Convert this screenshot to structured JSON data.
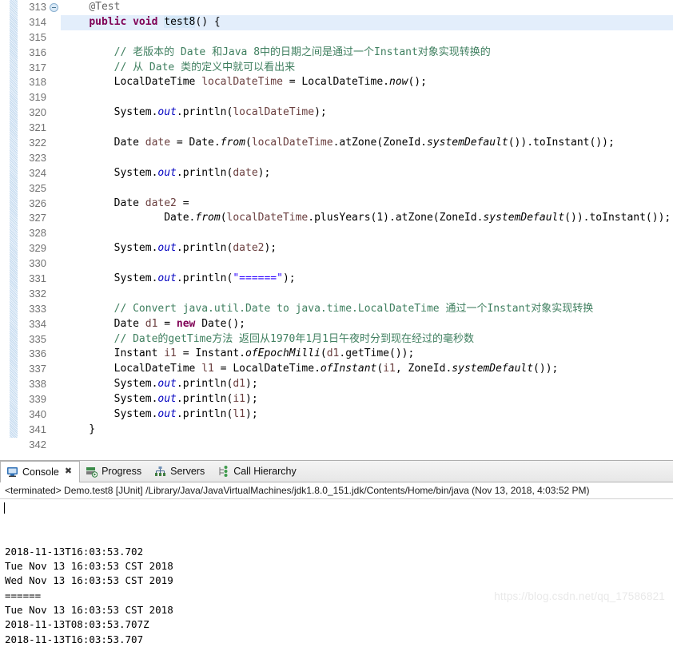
{
  "editor": {
    "first_line_number": 313,
    "highlighted_line_number": 314,
    "occurrence_token": "test8",
    "lines": [
      {
        "n": 313,
        "fold": true,
        "text": "    @Test"
      },
      {
        "n": 314,
        "fold": false,
        "text": "    public void test8() {"
      },
      {
        "n": 315,
        "fold": false,
        "text": ""
      },
      {
        "n": 316,
        "fold": false,
        "text": "        // 老版本的 Date 和Java 8中的日期之间是通过一个Instant对象实现转换的"
      },
      {
        "n": 317,
        "fold": false,
        "text": "        // 从 Date 类的定义中就可以看出来"
      },
      {
        "n": 318,
        "fold": false,
        "text": "        LocalDateTime localDateTime = LocalDateTime.now();"
      },
      {
        "n": 319,
        "fold": false,
        "text": ""
      },
      {
        "n": 320,
        "fold": false,
        "text": "        System.out.println(localDateTime);"
      },
      {
        "n": 321,
        "fold": false,
        "text": ""
      },
      {
        "n": 322,
        "fold": false,
        "text": "        Date date = Date.from(localDateTime.atZone(ZoneId.systemDefault()).toInstant());"
      },
      {
        "n": 323,
        "fold": false,
        "text": ""
      },
      {
        "n": 324,
        "fold": false,
        "text": "        System.out.println(date);"
      },
      {
        "n": 325,
        "fold": false,
        "text": ""
      },
      {
        "n": 326,
        "fold": false,
        "text": "        Date date2 ="
      },
      {
        "n": 327,
        "fold": false,
        "text": "                Date.from(localDateTime.plusYears(1).atZone(ZoneId.systemDefault()).toInstant());"
      },
      {
        "n": 328,
        "fold": false,
        "text": ""
      },
      {
        "n": 329,
        "fold": false,
        "text": "        System.out.println(date2);"
      },
      {
        "n": 330,
        "fold": false,
        "text": ""
      },
      {
        "n": 331,
        "fold": false,
        "text": "        System.out.println(\"======\");"
      },
      {
        "n": 332,
        "fold": false,
        "text": ""
      },
      {
        "n": 333,
        "fold": false,
        "text": "        // Convert java.util.Date to java.time.LocalDateTime 通过一个Instant对象实现转换"
      },
      {
        "n": 334,
        "fold": false,
        "text": "        Date d1 = new Date();"
      },
      {
        "n": 335,
        "fold": false,
        "text": "        // Date的getTime方法 返回从1970年1月1日午夜时分到现在经过的毫秒数"
      },
      {
        "n": 336,
        "fold": false,
        "text": "        Instant i1 = Instant.ofEpochMilli(d1.getTime());"
      },
      {
        "n": 337,
        "fold": false,
        "text": "        LocalDateTime l1 = LocalDateTime.ofInstant(i1, ZoneId.systemDefault());"
      },
      {
        "n": 338,
        "fold": false,
        "text": "        System.out.println(d1);"
      },
      {
        "n": 339,
        "fold": false,
        "text": "        System.out.println(i1);"
      },
      {
        "n": 340,
        "fold": false,
        "text": "        System.out.println(l1);"
      },
      {
        "n": 341,
        "fold": false,
        "text": "    }"
      },
      {
        "n": 342,
        "fold": false,
        "text": ""
      }
    ]
  },
  "bottom_panel": {
    "tabs": [
      {
        "label": "Console",
        "icon": "console-icon",
        "active": true,
        "closable": true
      },
      {
        "label": "Progress",
        "icon": "progress-icon",
        "active": false,
        "closable": false
      },
      {
        "label": "Servers",
        "icon": "servers-icon",
        "active": false,
        "closable": false
      },
      {
        "label": "Call Hierarchy",
        "icon": "call-hierarchy-icon",
        "active": false,
        "closable": false
      }
    ],
    "launch_line": "<terminated> Demo.test8 [JUnit] /Library/Java/JavaVirtualMachines/jdk1.8.0_151.jdk/Contents/Home/bin/java (Nov 13, 2018, 4:03:52 PM)",
    "console_output": [
      "2018-11-13T16:03:53.702",
      "Tue Nov 13 16:03:53 CST 2018",
      "Wed Nov 13 16:03:53 CST 2019",
      "======",
      "Tue Nov 13 16:03:53 CST 2018",
      "2018-11-13T08:03:53.707Z",
      "2018-11-13T16:03:53.707"
    ]
  },
  "watermark": {
    "text": "https://blog.csdn.net/qq_17586821"
  },
  "colors": {
    "keyword": "#7f0055",
    "comment": "#3f7f5f",
    "string": "#2a00ff",
    "field": "#0000c0",
    "local": "#6a3e3e",
    "line_highlight": "#e3eefb",
    "occurrence_highlight": "#d4e7f7"
  }
}
